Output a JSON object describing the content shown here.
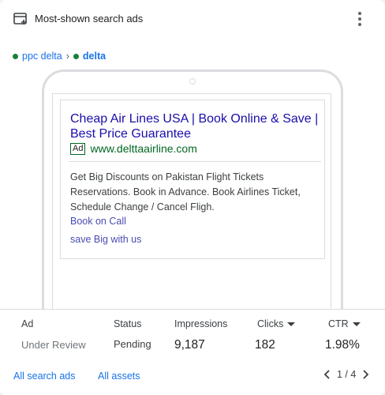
{
  "header": {
    "title": "Most-shown search ads",
    "icon": "ad-preview-icon",
    "more_icon": "more-vert-icon"
  },
  "breadcrumb": {
    "campaign": "ppc delta",
    "separator": "›",
    "ad_group": "delta",
    "status_color": "#188038"
  },
  "ad": {
    "headline": "Cheap Air Lines USA | Book Online & Save | Best Price Guarantee",
    "badge": "Ad",
    "display_url": "www.delttaairline.com",
    "description": "Get Big Discounts on Pakistan Flight Tickets Reservations. Book in Advance. Book Airlines Ticket, Schedule Change / Cancel Fligh.",
    "sitelinks": [
      "Book on Call",
      "save Big with us"
    ]
  },
  "stats": {
    "columns": {
      "ad": "Ad",
      "status": "Status",
      "impressions": "Impressions",
      "clicks": "Clicks",
      "ctr": "CTR"
    },
    "row": {
      "ad": "Under Review",
      "status": "Pending",
      "impressions": "9,187",
      "clicks": "182",
      "ctr": "1.98%"
    }
  },
  "footer": {
    "all_search_ads": "All search ads",
    "all_assets": "All assets",
    "page_indicator": "1 / 4"
  },
  "colors": {
    "link": "#1a73e8",
    "headline": "#1a0dab",
    "url": "#006621",
    "sitelink": "#4b4bb3"
  }
}
